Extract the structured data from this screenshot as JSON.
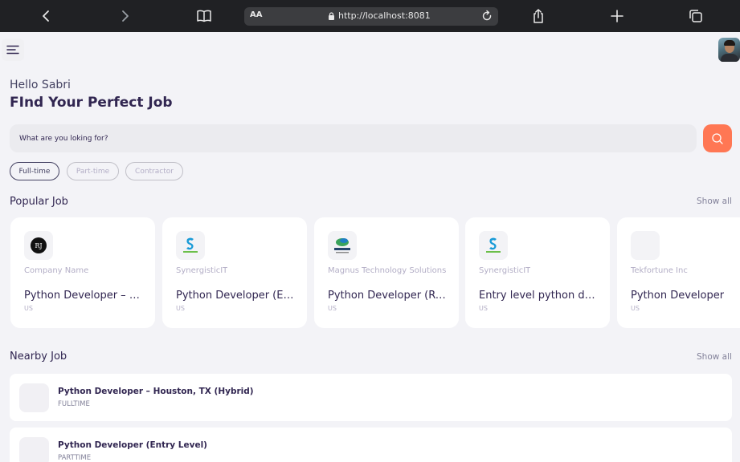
{
  "browser": {
    "aa_label": "AA",
    "url": "http://localhost:8081"
  },
  "header": {
    "menu_icon": "hamburger-menu-icon",
    "avatar_icon": "profile-avatar"
  },
  "welcome": {
    "greeting": "Hello Sabri",
    "title": "FInd Your Perfect Job"
  },
  "search": {
    "placeholder": "What are you loking for?",
    "value": "",
    "button_icon": "search-icon"
  },
  "job_types": [
    {
      "label": "Full-time",
      "active": true
    },
    {
      "label": "Part-time",
      "active": false
    },
    {
      "label": "Contractor",
      "active": false
    }
  ],
  "popular": {
    "title": "Popular Job",
    "show_all": "Show all",
    "cards": [
      {
        "company": "Company Name",
        "job": "Python Developer – Houston, TX (Hybrid)",
        "location": "US",
        "logo": "rj-logo"
      },
      {
        "company": "SynergisticIT",
        "job": "Python Developer (Entry Level)",
        "location": "US",
        "logo": "synergisticit-logo"
      },
      {
        "company": "Magnus Technology Solutions",
        "job": "Python Developer (Remote)",
        "location": "US",
        "logo": "magnus-logo"
      },
      {
        "company": "SynergisticIT",
        "job": "Entry level python developer",
        "location": "US",
        "logo": "synergisticit-logo"
      },
      {
        "company": "Tekfortune Inc",
        "job": "Python Developer",
        "location": "US",
        "logo": "blank-logo"
      }
    ]
  },
  "nearby": {
    "title": "Nearby Job",
    "show_all": "Show all",
    "items": [
      {
        "title": "Python Developer – Houston, TX (Hybrid)",
        "type": "FULLTIME"
      },
      {
        "title": "Python Developer (Entry Level)",
        "type": "PARTTIME"
      }
    ]
  },
  "colors": {
    "primary": "#312651",
    "tertiary": "#ff7754",
    "gray": "#83829a",
    "gray2": "#b3aec6",
    "background": "#f3f3f7"
  }
}
